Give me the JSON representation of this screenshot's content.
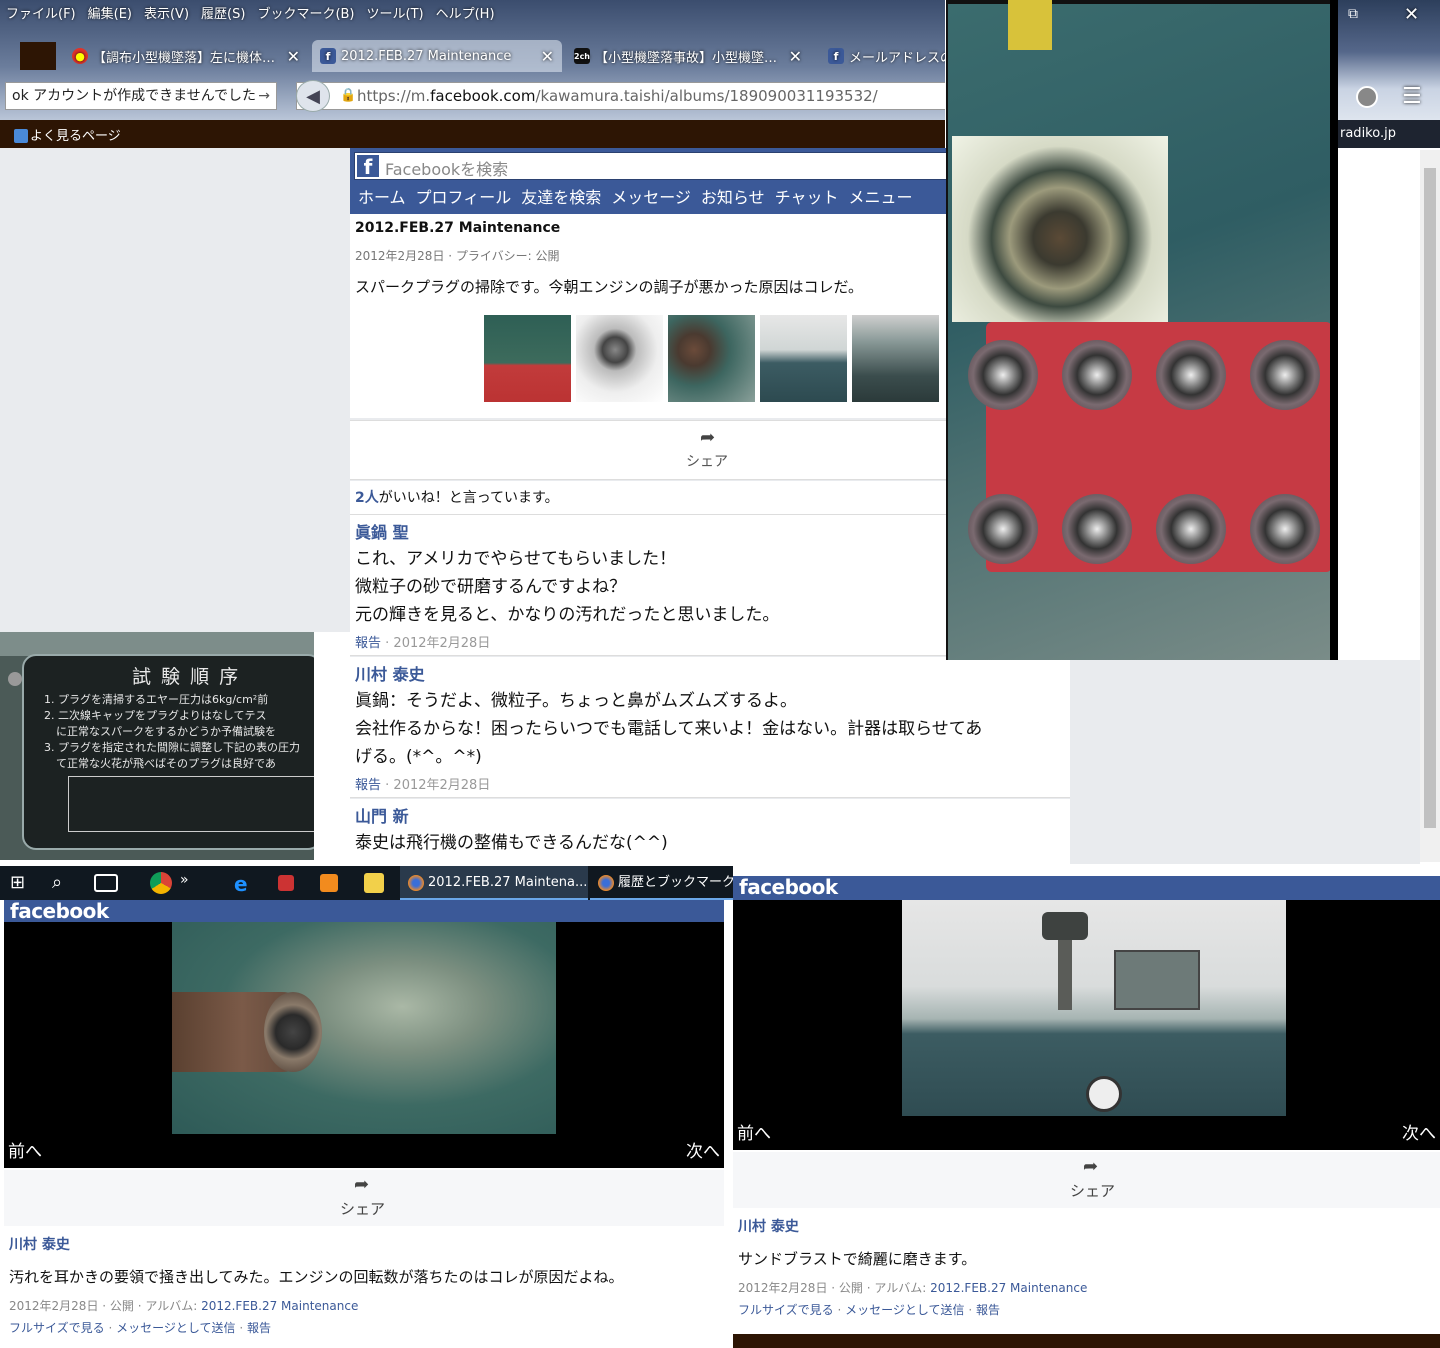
{
  "browser": {
    "menu": [
      "ファイル(F)",
      "編集(E)",
      "表示(V)",
      "履歴(S)",
      "ブックマーク(B)",
      "ツール(T)",
      "ヘルプ(H)"
    ],
    "tabs": [
      {
        "label": "【調布小型機墜落】左に機体…",
        "active": false
      },
      {
        "label": "2012.FEB.27 Maintenance",
        "active": true
      },
      {
        "label": "【小型機墜落事故】小型機墜…",
        "active": false
      },
      {
        "label": "メールアドレスの詳",
        "active": false
      }
    ],
    "search_value": "ok アカウントが作成できませんでした",
    "url_prefix": "https://m.",
    "url_domain": "facebook.com",
    "url_path": "/kawamura.taishi/albums/189090031193532/",
    "bookmark": "よく見るページ",
    "radiko": "radiko.jp"
  },
  "fb": {
    "search_placeholder": "Facebookを検索",
    "nav": [
      "ホーム",
      "プロフィール",
      "友達を検索",
      "メッセージ",
      "お知らせ",
      "チャット",
      "メニュー"
    ],
    "album_title": "2012.FEB.27 Maintenance",
    "album_date": "2012年2月28日 · プライバシー: 公開",
    "album_desc": "スパークプラグの掃除です。今朝エンジンの調子が悪かった原因はコレだ。",
    "share": "シェア",
    "likes_count": "2人",
    "likes_text": "がいいね！と言っています。",
    "comments": [
      {
        "name": "眞鍋 聖",
        "lines": [
          "これ、アメリカでやらせてもらいました！",
          "微粒子の砂で研磨するんですよね？",
          "元の輝きを見ると、かなりの汚れだったと思いました。"
        ],
        "report": "報告",
        "date": "2012年2月28日"
      },
      {
        "name": "川村 泰史",
        "lines": [
          "眞鍋：そうだよ、微粒子。ちょっと鼻がムズムズするよ。",
          "会社作るからな！困ったらいつでも電話して来いよ！金はない。計器は取らせてあ",
          "げる。(*^。^*)"
        ],
        "report": "報告",
        "date": "2012年2月28日"
      },
      {
        "name": "山門 新",
        "lines": [
          "泰史は飛行機の整備もできるんだな(^^)"
        ]
      }
    ]
  },
  "plate": {
    "title": "試 験 順 序",
    "lines": [
      "1. プラグを清掃するエヤー圧力は6kg/cm²前",
      "2. 二次線キャップをプラグよりはなしてテス",
      "に正常なスパークをするかどうか予備試験を",
      "3. プラグを指定された間隙に調整し下記の表の圧力",
      "て正常な火花が飛べばそのプラグは良好であ"
    ]
  },
  "taskbar": {
    "task1": "2012.FEB.27 Maintena...",
    "task2": "履歴とブックマークの管"
  },
  "win1": {
    "logo": "facebook",
    "prev": "前へ",
    "next": "次へ",
    "share": "シェア",
    "name": "川村 泰史",
    "text": "汚れを耳かきの要領で掻き出してみた。エンジンの回転数が落ちたのはコレが原因だよね。",
    "date": "2012年2月28日 · 公開 · アルバム: ",
    "album": "2012.FEB.27 Maintenance",
    "links": [
      "フルサイズで見る",
      "メッセージとして送信",
      "報告"
    ]
  },
  "win2": {
    "logo": "facebook",
    "prev": "前へ",
    "next": "次へ",
    "share": "シェア",
    "name": "川村 泰史",
    "text": "サンドブラストで綺麗に磨きます。",
    "date": "2012年2月28日 · 公開 · アルバム: ",
    "album": "2012.FEB.27 Maintenance",
    "links": [
      "フルサイズで見る",
      "メッセージとして送信",
      "報告"
    ]
  },
  "colors": {
    "fb_blue": "#3b5998",
    "bookmark_bar": "#2d1504",
    "taskbar": "#101820"
  }
}
